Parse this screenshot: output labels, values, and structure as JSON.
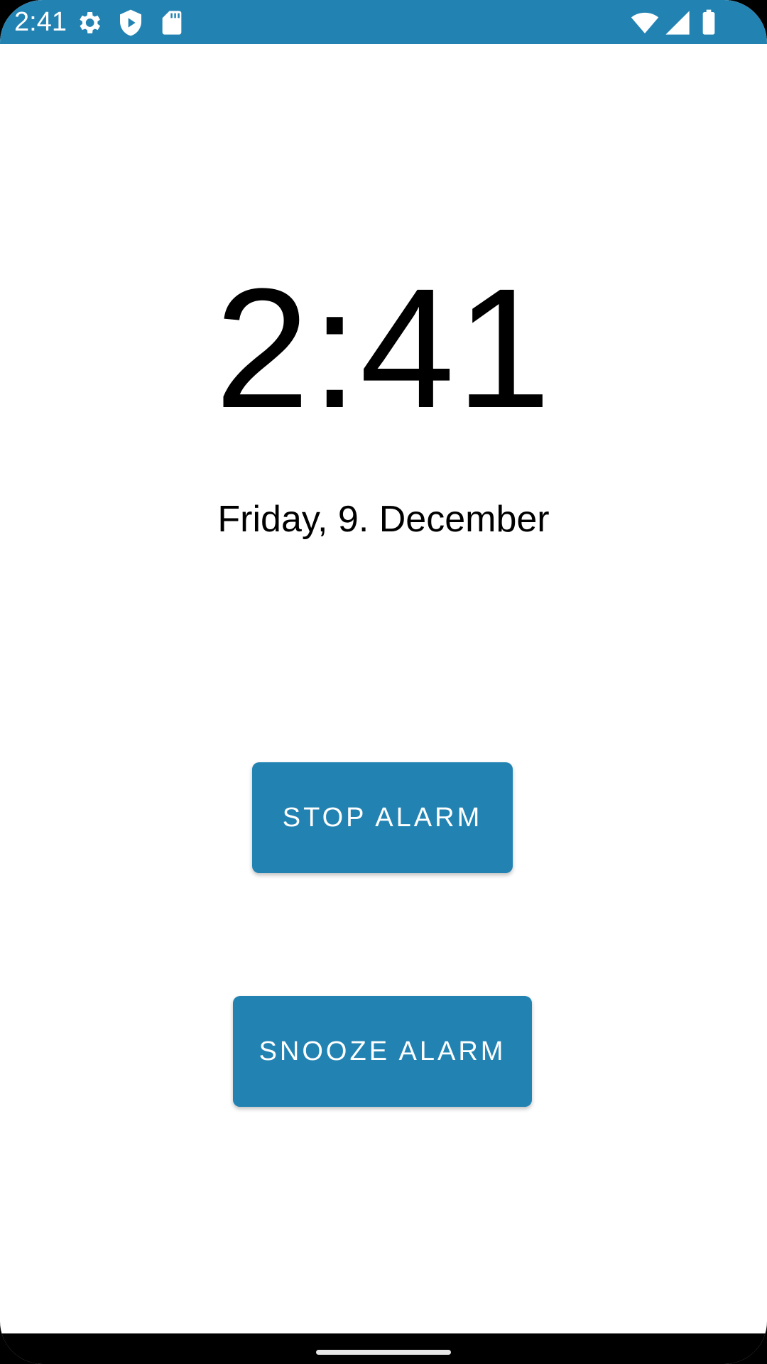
{
  "status_bar": {
    "time": "2:41",
    "icons_left": [
      "settings-icon",
      "shield-play-icon",
      "sd-card-icon"
    ],
    "icons_right": [
      "wifi-icon",
      "cell-signal-icon",
      "battery-icon"
    ],
    "background": "#2283b3"
  },
  "clock": {
    "time": "2:41",
    "date": "Friday, 9. December"
  },
  "actions": {
    "stop_label": "STOP ALARM",
    "snooze_label": "SNOOZE ALARM",
    "accent": "#2283b3"
  }
}
